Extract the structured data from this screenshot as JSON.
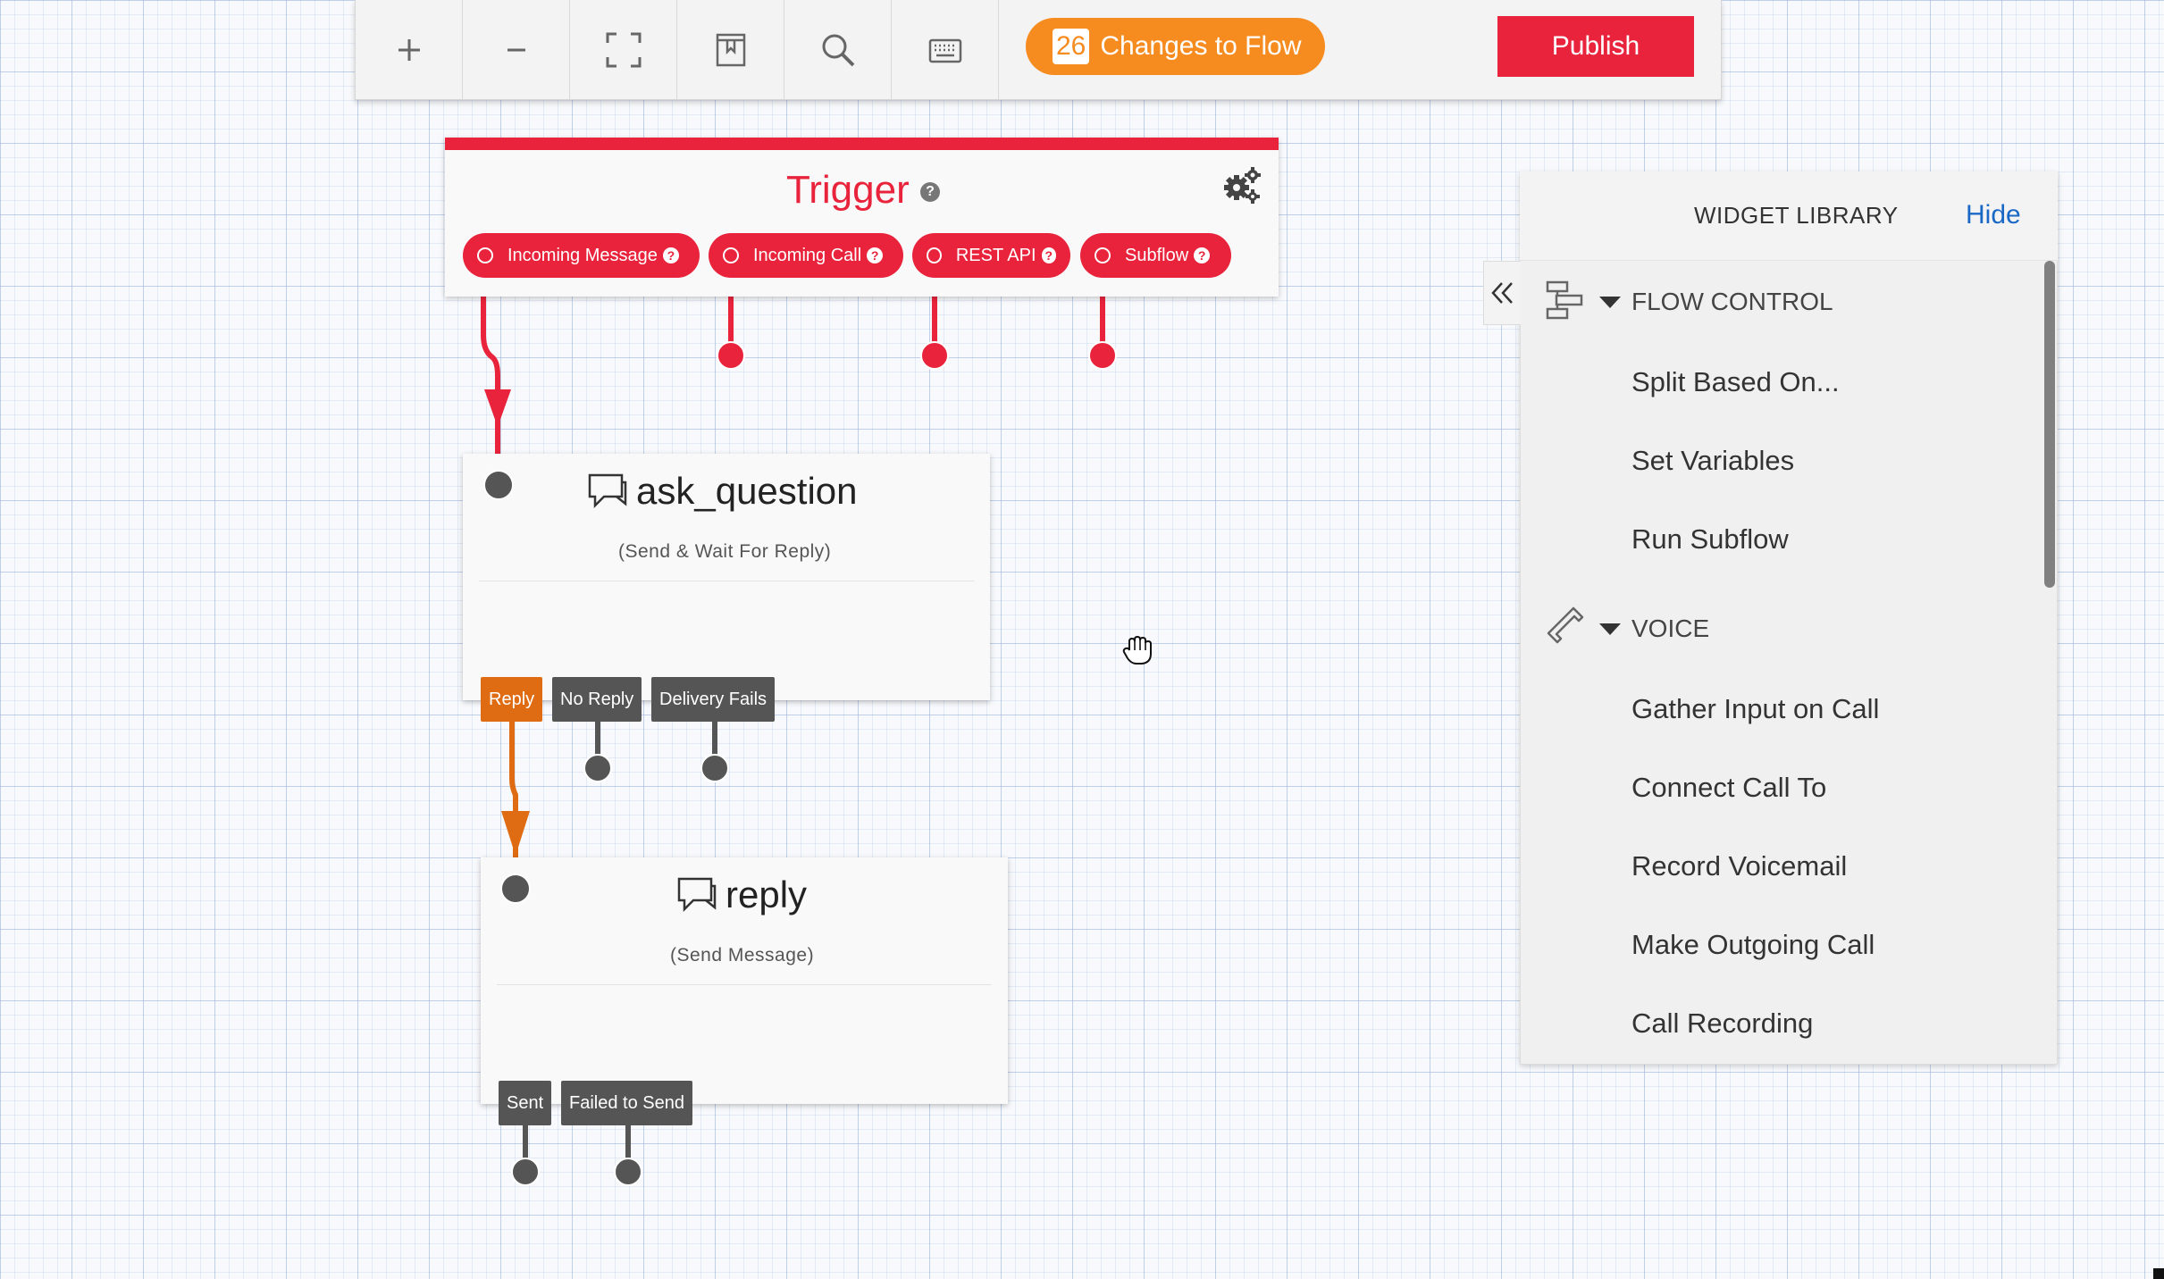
{
  "toolbar": {
    "buttons": [
      "zoom-in",
      "zoom-out",
      "fit-screen",
      "bookmark",
      "search",
      "keyboard"
    ],
    "changes_count": "26",
    "changes_label": "Changes to Flow",
    "publish_label": "Publish"
  },
  "trigger": {
    "title": "Trigger",
    "pills": [
      "Incoming Message",
      "Incoming Call",
      "REST API",
      "Subflow"
    ]
  },
  "widgets": [
    {
      "name": "ask_question",
      "subtitle": "(Send & Wait For Reply)",
      "transitions": [
        "Reply",
        "No Reply",
        "Delivery Fails"
      ]
    },
    {
      "name": "reply",
      "subtitle": "(Send Message)",
      "transitions": [
        "Sent",
        "Failed to Send"
      ]
    }
  ],
  "library": {
    "title": "WIDGET LIBRARY",
    "hide_label": "Hide",
    "categories": [
      {
        "name": "FLOW CONTROL",
        "icon": "flow-control-icon",
        "items": [
          "Split Based On...",
          "Set Variables",
          "Run Subflow"
        ]
      },
      {
        "name": "VOICE",
        "icon": "phone-icon",
        "items": [
          "Gather Input on Call",
          "Connect Call To",
          "Record Voicemail",
          "Make Outgoing Call",
          "Call Recording"
        ]
      }
    ]
  },
  "colors": {
    "accent_red": "#e8233b",
    "accent_orange": "#f68b1f",
    "transition_orange": "#df6b12",
    "link_blue": "#1a68c6",
    "node_dark": "#555555"
  }
}
